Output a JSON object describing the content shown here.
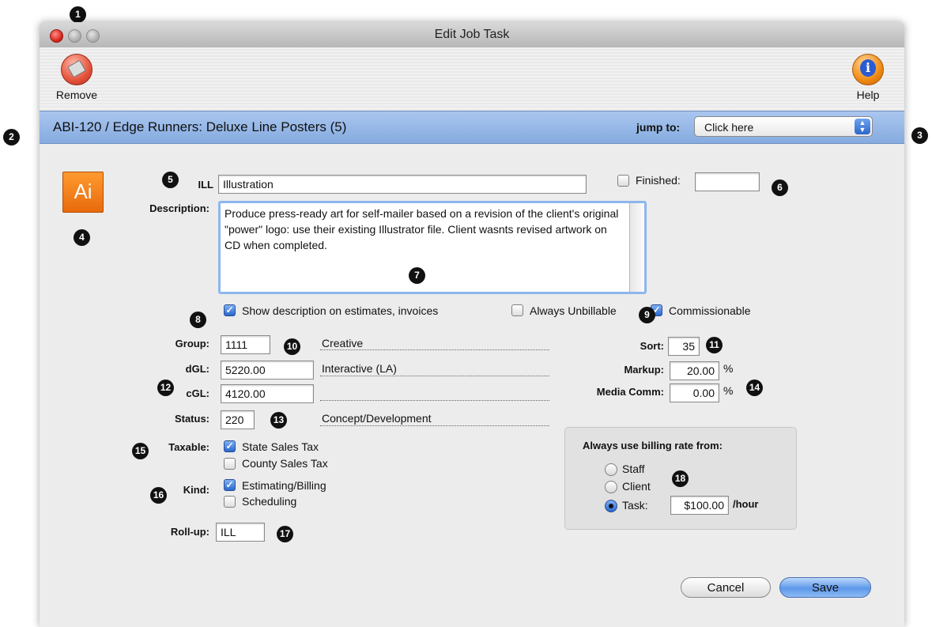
{
  "window": {
    "title": "Edit Job Task"
  },
  "toolbar": {
    "remove_label": "Remove",
    "help_label": "Help"
  },
  "header": {
    "title": "ABI-120 / Edge Runners:  Deluxe Line Posters (5)",
    "jump_label": "jump to:",
    "jump_value": "Click here"
  },
  "task": {
    "icon_text": "Ai",
    "code_label": "ILL",
    "name": "Illustration",
    "finished_label": "Finished:",
    "finished_value": "",
    "description_label": "Description:",
    "description": "Produce press-ready art for self-mailer based on a revision of the client's original \"power\" logo: use their existing Illustrator file. Client wasnts revised artwork on CD when completed."
  },
  "options": {
    "show_description": {
      "label": "Show description on estimates, invoices",
      "checked": true
    },
    "always_unbillable": {
      "label": "Always Unbillable",
      "checked": false
    },
    "commissionable": {
      "label": "Commissionable",
      "checked": true
    }
  },
  "fields": {
    "group_label": "Group:",
    "group": "1111",
    "group_name": "Creative",
    "dgl_label": "dGL:",
    "dgl": "5220.00",
    "dgl_name": "Interactive (LA)",
    "cgl_label": "cGL:",
    "cgl": "4120.00",
    "cgl_name": "",
    "status_label": "Status:",
    "status": "220",
    "status_name": "Concept/Development",
    "sort_label": "Sort:",
    "sort": "35",
    "markup_label": "Markup:",
    "markup": "20.00",
    "markup_unit": "%",
    "media_label": "Media Comm:",
    "media": "0.00",
    "media_unit": "%",
    "rollup_label": "Roll-up:",
    "rollup": "ILL"
  },
  "taxable": {
    "label": "Taxable:",
    "state": {
      "label": "State Sales Tax",
      "checked": true
    },
    "county": {
      "label": "County Sales Tax",
      "checked": false
    }
  },
  "kind": {
    "label": "Kind:",
    "estimating": {
      "label": "Estimating/Billing",
      "checked": true
    },
    "scheduling": {
      "label": "Scheduling",
      "checked": false
    }
  },
  "billing_rate": {
    "title": "Always use billing rate from:",
    "staff": "Staff",
    "client": "Client",
    "task": "Task:",
    "selected": "Task:",
    "task_rate": "$100.00",
    "unit": "/hour"
  },
  "buttons": {
    "cancel": "Cancel",
    "save": "Save"
  },
  "markers": [
    "1",
    "2",
    "3",
    "4",
    "5",
    "6",
    "7",
    "8",
    "9",
    "10",
    "11",
    "12",
    "13",
    "14",
    "15",
    "16",
    "17",
    "18"
  ]
}
